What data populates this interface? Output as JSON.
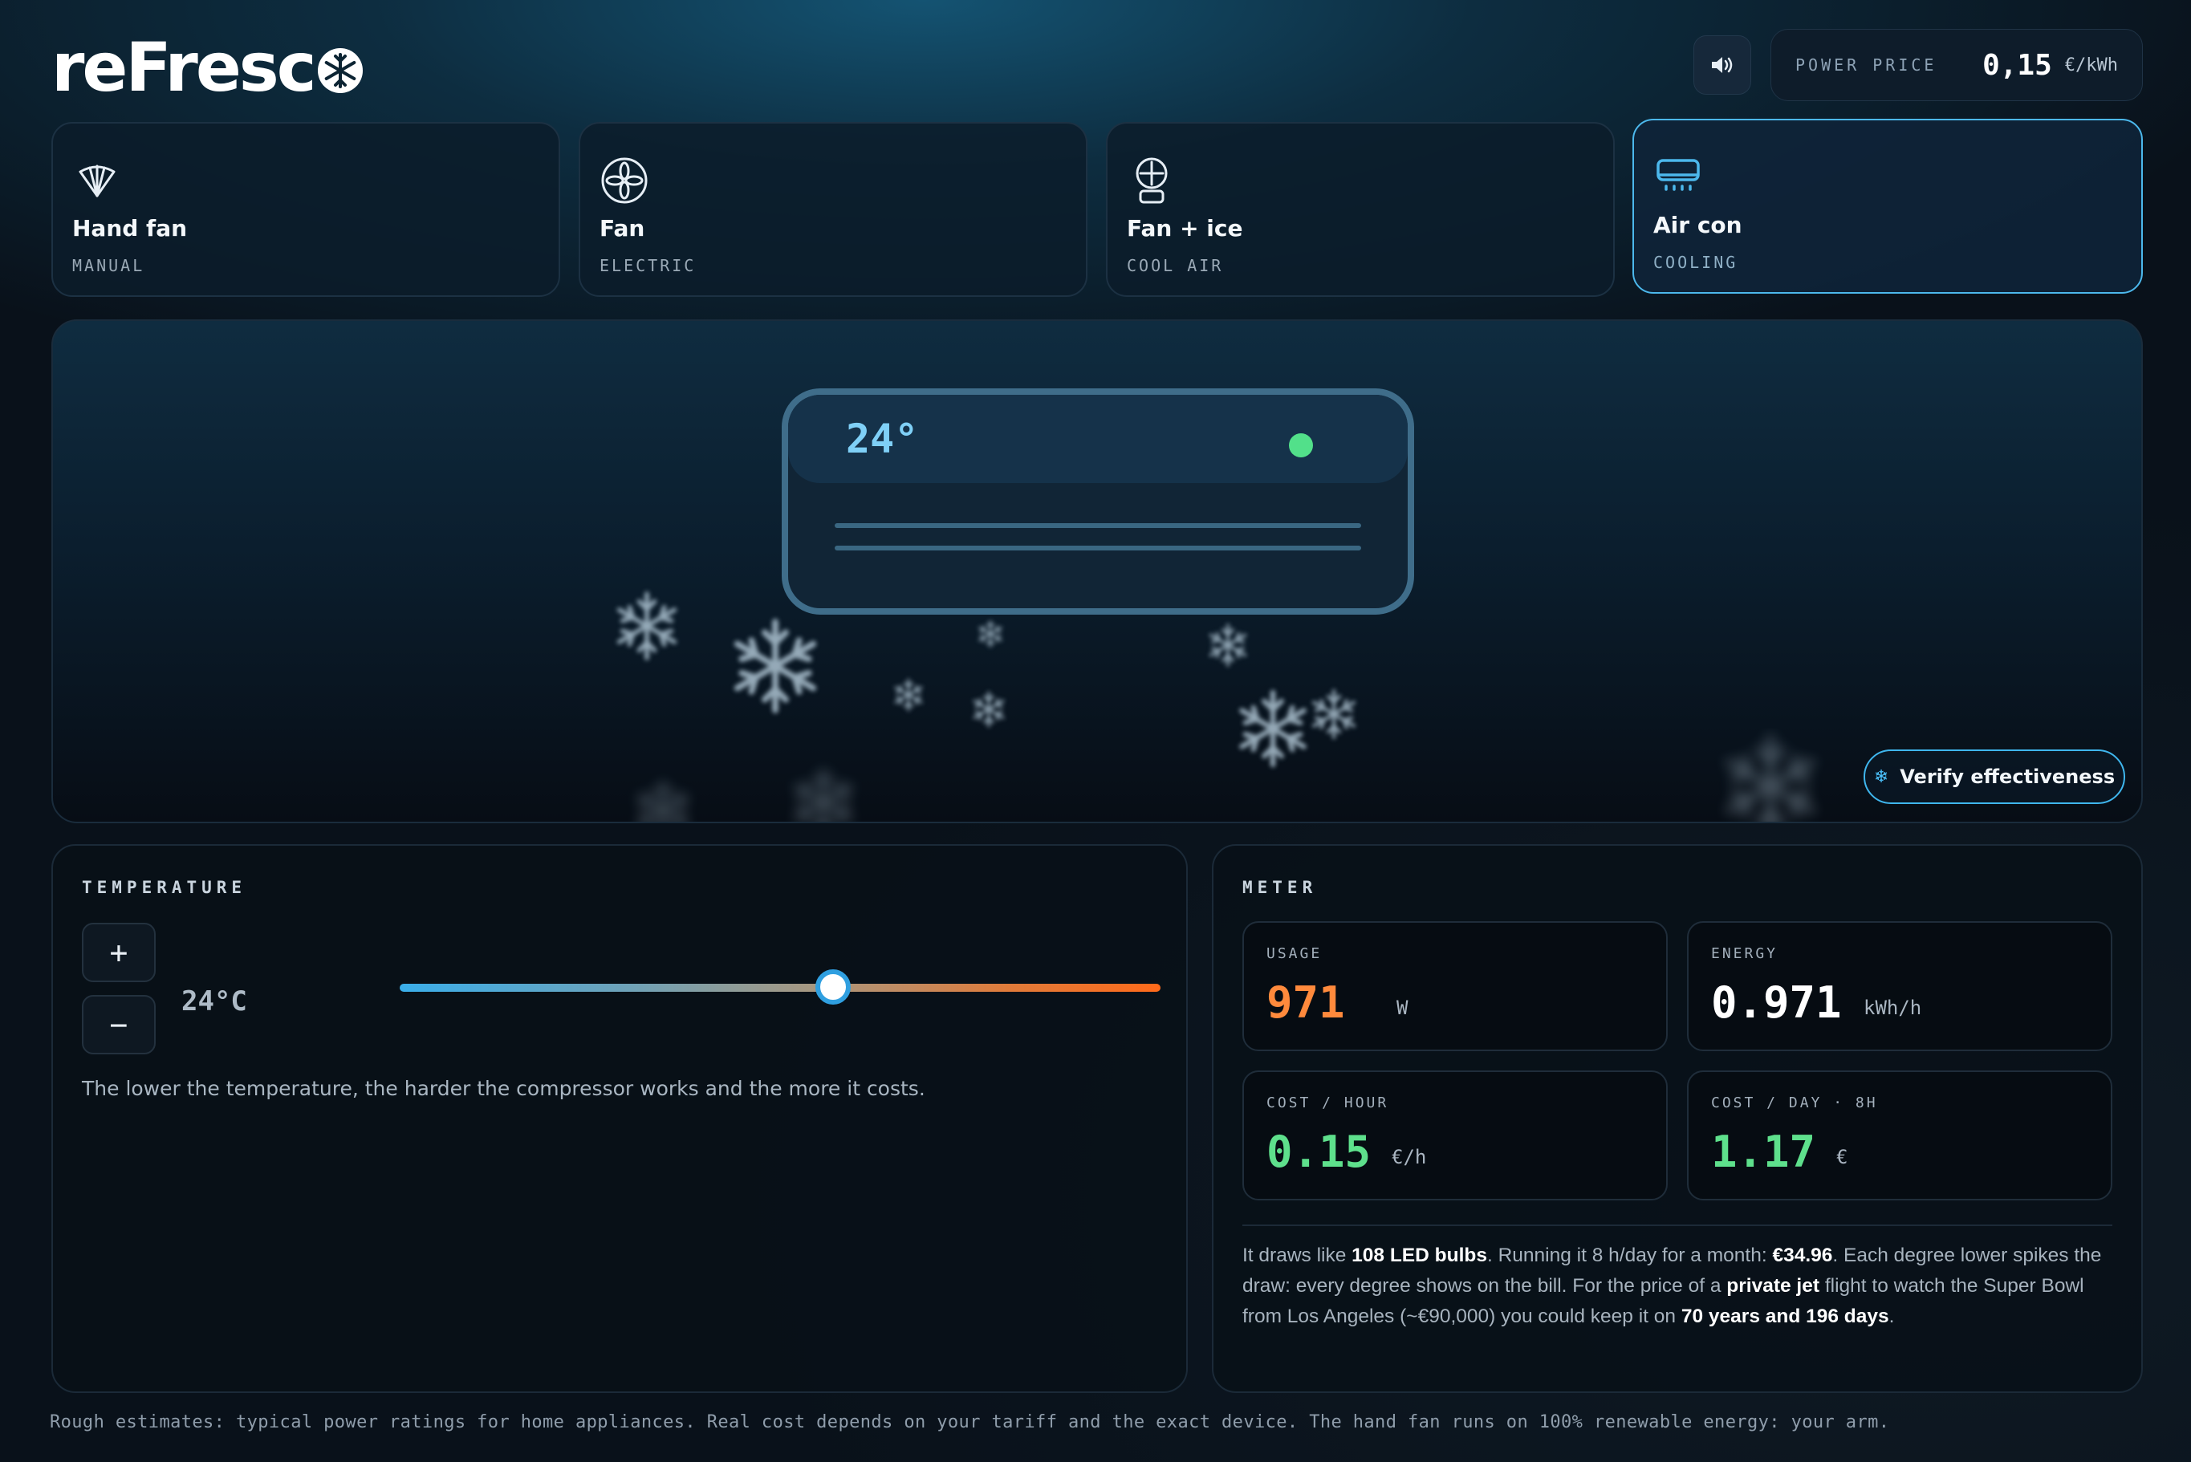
{
  "app": {
    "logo_text": "reFresc",
    "logo_icon": "snowflake-icon"
  },
  "header": {
    "sound_icon": "speaker-icon",
    "power_price": {
      "label": "POWER PRICE",
      "value": "0,15",
      "unit": "€/kWh"
    }
  },
  "modes": [
    {
      "name": "Hand fan",
      "subtitle": "MANUAL",
      "icon": "hand-fan-icon",
      "active": false
    },
    {
      "name": "Fan",
      "subtitle": "ELECTRIC",
      "icon": "fan-icon",
      "active": false
    },
    {
      "name": "Fan + ice",
      "subtitle": "COOL AIR",
      "icon": "fan-ice-icon",
      "active": false
    },
    {
      "name": "Air con",
      "subtitle": "COOLING",
      "icon": "air-con-icon",
      "active": true
    }
  ],
  "stage": {
    "ac_display": "24°",
    "status_led_color": "#52e08a",
    "verify_label": "Verify effectiveness"
  },
  "temperature": {
    "title": "TEMPERATURE",
    "plus_label": "+",
    "minus_label": "−",
    "value": "24°C",
    "slider_fraction": 0.57,
    "hint": "The lower the temperature, the harder the compressor works and the more it costs."
  },
  "meter": {
    "title": "METER",
    "usage": {
      "label": "USAGE",
      "value": "971",
      "unit": "W"
    },
    "energy": {
      "label": "ENERGY",
      "value": "0.971",
      "unit": "kWh/h"
    },
    "cost_hour": {
      "label": "COST / HOUR",
      "value": "0.15",
      "unit": "€/h"
    },
    "cost_day": {
      "label": "COST / DAY · 8H",
      "value": "1.17",
      "unit": "€"
    },
    "summary": {
      "t1": "It draws like ",
      "b1": "108 LED bulbs",
      "t2": ". Running it 8 h/day for a month: ",
      "b2": "€34.96",
      "t3": ". Each degree lower spikes the draw: every degree shows on the bill. For the price of a ",
      "b3": "private jet",
      "t4": " flight to watch the Super Bowl from Los Angeles (~€90,000) you could keep it on ",
      "b4": "70 years and 196 days",
      "t5": "."
    }
  },
  "footer": "Rough estimates: typical power ratings for home appliances. Real cost depends on your tariff and the exact device. The hand fan runs on 100% renewable energy: your arm.",
  "colors": {
    "accent": "#4cb8ec",
    "usage": "#ff8a3c",
    "cost": "#5ee08c"
  }
}
